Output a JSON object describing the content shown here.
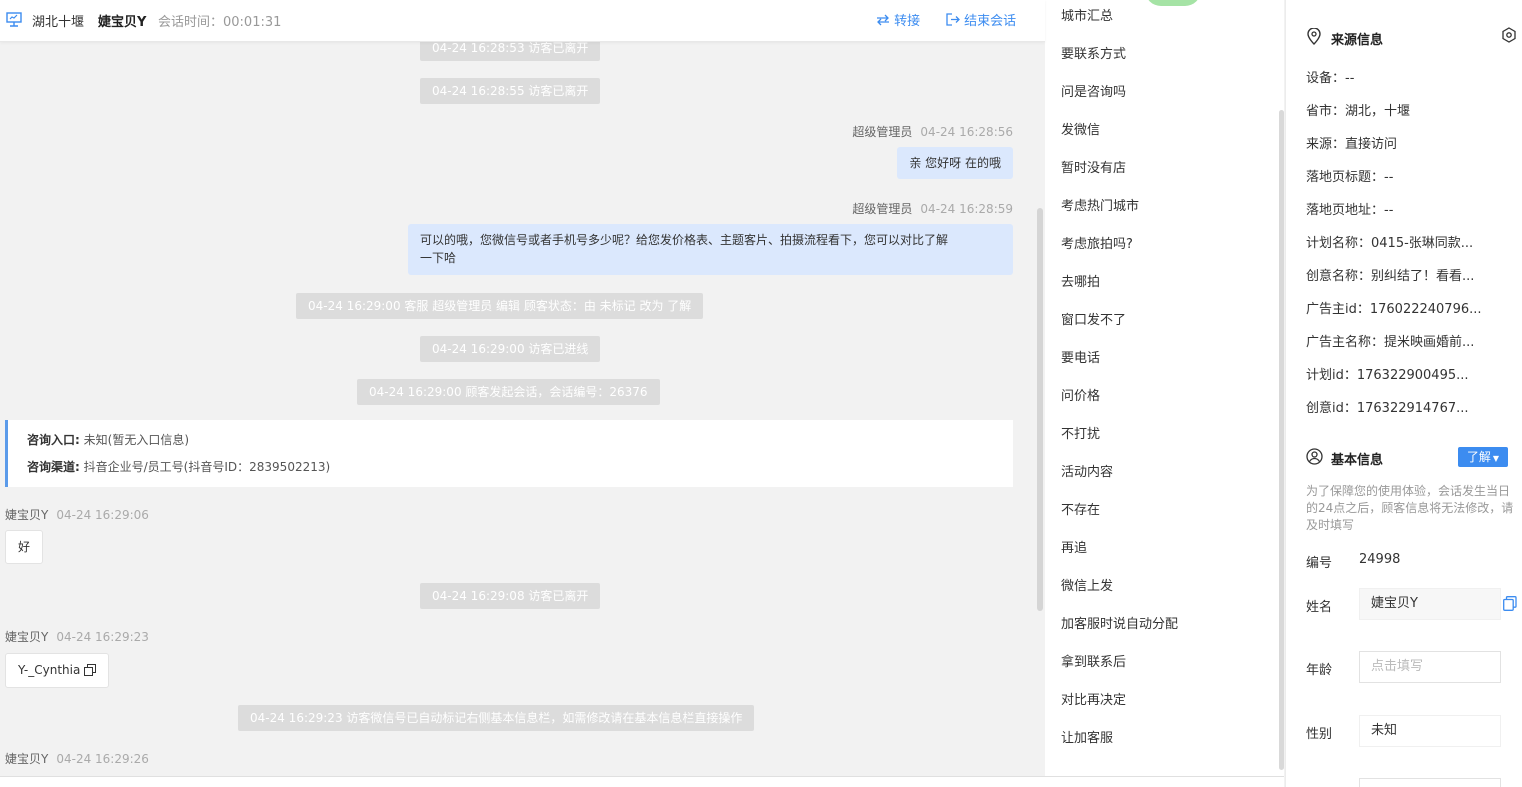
{
  "header": {
    "location": "湖北十堰",
    "visitor": "婕宝贝Y",
    "session_time": "会话时间：00:01:31",
    "transfer": "转接",
    "end_session": "结束会话"
  },
  "chat": {
    "sys_top1": "04-24 16:28:53 访客已离开",
    "sys_top2": "04-24 16:28:55 访客已离开",
    "msg1_sender": "超级管理员",
    "msg1_time": "04-24 16:28:56",
    "msg1_text": "亲 您好呀 在的哦",
    "msg2_sender": "超级管理员",
    "msg2_time": "04-24 16:28:59",
    "msg2_line1": "可以的哦，您微信号或者手机号多少呢？给您发价格表、主题客片、拍摄流程看下，您可以对比了解",
    "msg2_line2": "一下哈",
    "sys_status": "04-24 16:29:00 客服 超级管理员 编辑 顾客状态：由 未标记 改为 了解",
    "sys_online": "04-24 16:29:00 访客已进线",
    "sys_session": "04-24 16:29:00 顾客发起会话，会话编号：26376",
    "entry_label": "咨询入口:",
    "entry_value": "未知(暂无入口信息)",
    "channel_label": "咨询渠道:",
    "channel_value": "抖音企业号/员工号(抖音号ID：2839502213)",
    "msg3_sender": "婕宝贝Y",
    "msg3_time": "04-24 16:29:06",
    "msg3_text": "好",
    "sys_leave": "04-24 16:29:08 访客已离开",
    "msg4_sender": "婕宝贝Y",
    "msg4_time": "04-24 16:29:23",
    "msg4_text": "Y-_Cynthia",
    "sys_wechat": "04-24 16:29:23 访客微信号已自动标记右侧基本信息栏，如需修改请在基本信息栏直接操作",
    "msg5_sender": "婕宝贝Y",
    "msg5_time": "04-24 16:29:26"
  },
  "phrases": [
    "城市汇总",
    "要联系方式",
    "问是咨询吗",
    "发微信",
    "暂时没有店",
    "考虑热门城市",
    "考虑旅拍吗?",
    "去哪拍",
    "窗口发不了",
    "要电话",
    "问价格",
    "不打扰",
    "活动内容",
    "不存在",
    "再追",
    "微信上发",
    "加客服时说自动分配",
    "拿到联系后",
    "对比再决定",
    "让加客服"
  ],
  "source": {
    "title": "来源信息",
    "device": "设备：--",
    "province": "省市：湖北，十堰",
    "origin": "来源：直接访问",
    "landing_title": "落地页标题：--",
    "landing_url": "落地页地址：--",
    "plan_name": "计划名称：0415-张琳同款...",
    "creative_name": "创意名称：别纠结了！看看...",
    "advertiser_id": "广告主id：176022240796...",
    "advertiser_name": "广告主名称：提米映画婚前...",
    "plan_id": "计划id：176322900495...",
    "creative_id": "创意id：176322914767..."
  },
  "basic": {
    "title": "基本信息",
    "tag": "了解",
    "hint": "为了保障您的使用体验，会话发生当日的24点之后，顾客信息将无法修改，请及时填写",
    "id_label": "编号",
    "id_value": "24998",
    "name_label": "姓名",
    "name_value": "婕宝贝Y",
    "age_label": "年龄",
    "age_placeholder": "点击填写",
    "gender_label": "性别",
    "gender_value": "未知"
  },
  "colors": {
    "accent": "#3c8cf0",
    "bubble": "#dbe8fd",
    "sys": "#dcdcdc"
  }
}
